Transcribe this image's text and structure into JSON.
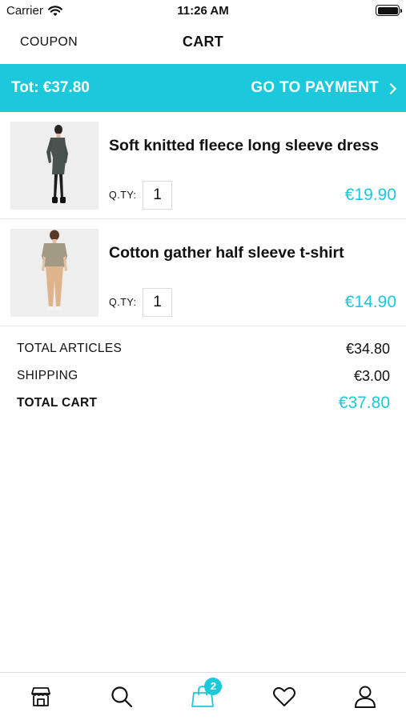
{
  "status_bar": {
    "carrier": "Carrier",
    "time": "11:26 AM"
  },
  "nav": {
    "coupon_label": "COUPON",
    "title": "CART"
  },
  "banner": {
    "total_text": "Tot: €37.80",
    "payment_label": "GO TO PAYMENT"
  },
  "items": [
    {
      "name": "Soft knitted fleece long sleeve dress",
      "qty_label": "Q.TY:",
      "qty": "1",
      "price": "€19.90",
      "image": "model-dark-dress"
    },
    {
      "name": "Cotton gather half sleeve t-shirt",
      "qty_label": "Q.TY:",
      "qty": "1",
      "price": "€14.90",
      "image": "model-beige-tshirt"
    }
  ],
  "summary": {
    "articles_label": "TOTAL ARTICLES",
    "articles_value": "€34.80",
    "shipping_label": "SHIPPING",
    "shipping_value": "€3.00",
    "total_label": "TOTAL CART",
    "total_value": "€37.80"
  },
  "tab_bar": {
    "tabs": [
      {
        "icon": "store-icon"
      },
      {
        "icon": "search-icon"
      },
      {
        "icon": "bag-icon",
        "active": true,
        "badge": "2"
      },
      {
        "icon": "heart-icon"
      },
      {
        "icon": "user-icon"
      }
    ]
  },
  "colors": {
    "accent": "#1cc8dc",
    "text": "#111111",
    "divider": "#e8e8e8"
  }
}
